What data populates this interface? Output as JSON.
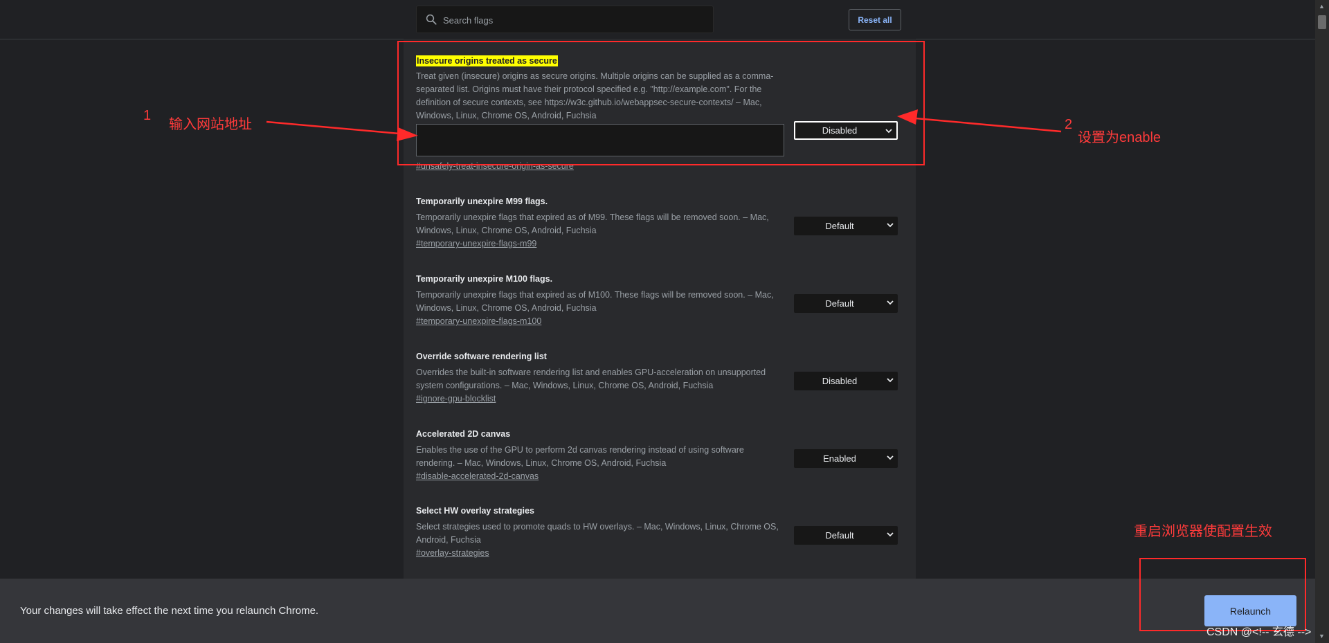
{
  "header": {
    "search_placeholder": "Search flags",
    "reset_label": "Reset all"
  },
  "flags": [
    {
      "title": "Insecure origins treated as secure",
      "description": "Treat given (insecure) origins as secure origins. Multiple origins can be supplied as a comma-separated list. Origins must have their protocol specified e.g. \"http://example.com\". For the definition of secure contexts, see https://w3c.github.io/webappsec-secure-contexts/ – Mac, Windows, Linux, Chrome OS, Android, Fuchsia",
      "link": "#unsafely-treat-insecure-origin-as-secure",
      "value": "Disabled",
      "input_value": ""
    },
    {
      "title": "Temporarily unexpire M99 flags.",
      "description": "Temporarily unexpire flags that expired as of M99. These flags will be removed soon. – Mac, Windows, Linux, Chrome OS, Android, Fuchsia",
      "link": "#temporary-unexpire-flags-m99",
      "value": "Default"
    },
    {
      "title": "Temporarily unexpire M100 flags.",
      "description": "Temporarily unexpire flags that expired as of M100. These flags will be removed soon. – Mac, Windows, Linux, Chrome OS, Android, Fuchsia",
      "link": "#temporary-unexpire-flags-m100",
      "value": "Default"
    },
    {
      "title": "Override software rendering list",
      "description": "Overrides the built-in software rendering list and enables GPU-acceleration on unsupported system configurations. – Mac, Windows, Linux, Chrome OS, Android, Fuchsia",
      "link": "#ignore-gpu-blocklist",
      "value": "Disabled"
    },
    {
      "title": "Accelerated 2D canvas",
      "description": "Enables the use of the GPU to perform 2d canvas rendering instead of using software rendering. – Mac, Windows, Linux, Chrome OS, Android, Fuchsia",
      "link": "#disable-accelerated-2d-canvas",
      "value": "Enabled"
    },
    {
      "title": "Select HW overlay strategies",
      "description": "Select strategies used to promote quads to HW overlays. – Mac, Windows, Linux, Chrome OS, Android, Fuchsia",
      "link": "#overlay-strategies",
      "value": "Default"
    }
  ],
  "footer": {
    "message": "Your changes will take effect the next time you relaunch Chrome.",
    "relaunch_label": "Relaunch"
  },
  "annotations": {
    "step1_number": "1",
    "step1_text": "输入网站地址",
    "step2_number": "2",
    "step2_text": "设置为enable",
    "relaunch_note": "重启浏览器使配置生效",
    "color": "#ff2a2a"
  },
  "watermark": "CSDN @<!-- 玄德 -->",
  "icons": {
    "search": "search-icon",
    "dropdown": "chevron-down-icon"
  }
}
